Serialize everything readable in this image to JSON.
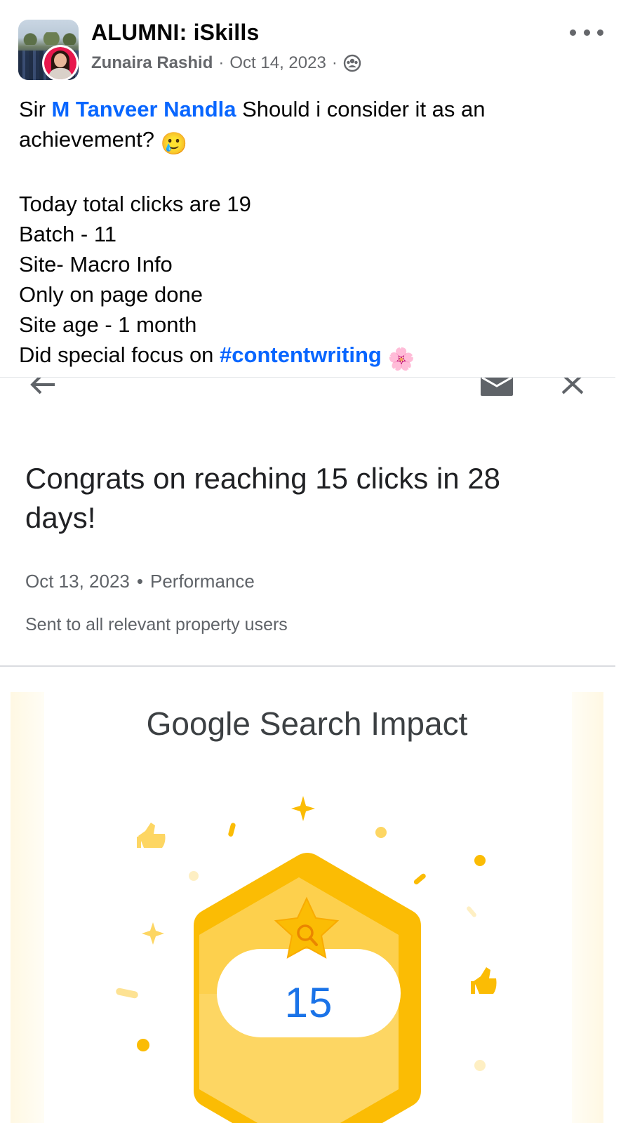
{
  "post": {
    "group_name": "ALUMNI: iSkills",
    "author": "Zunaira Rashid",
    "date": "Oct 14, 2023",
    "separator": "·",
    "privacy_icon": "group-privacy-icon",
    "more_icon": "more-options-icon"
  },
  "body": {
    "greeting": "Sir ",
    "mention": "M Tanveer Nandla",
    "question_part1": " Should i consider it as an",
    "question_part2": "achievement? ",
    "emoji_1": "🥲",
    "lines": [
      "Today total clicks are 19",
      "Batch - 11",
      "Site- Macro Info",
      "Only on page done",
      "Site age - 1 month"
    ],
    "last_line_prefix": "Did special focus on ",
    "hashtag": "#contentwriting",
    "emoji_2": "🌸"
  },
  "screenshot": {
    "toolbar_icons": [
      "back-arrow-icon",
      "mail-icon",
      "close-icon"
    ],
    "congrats_title": "Congrats on reaching 15 clicks in 28 days!",
    "message_date": "Oct 13, 2023",
    "meta_separator": "•",
    "category": "Performance",
    "sent_to": "Sent to all relevant property users",
    "card_title": "Google Search Impact",
    "badge_value": "15",
    "badge_icon": "search-star-icon",
    "colors": {
      "badge_outer": "#ffc107",
      "badge_inner": "#ffd54f",
      "number": "#1a73e8",
      "accent_link": "#0866ff"
    }
  }
}
